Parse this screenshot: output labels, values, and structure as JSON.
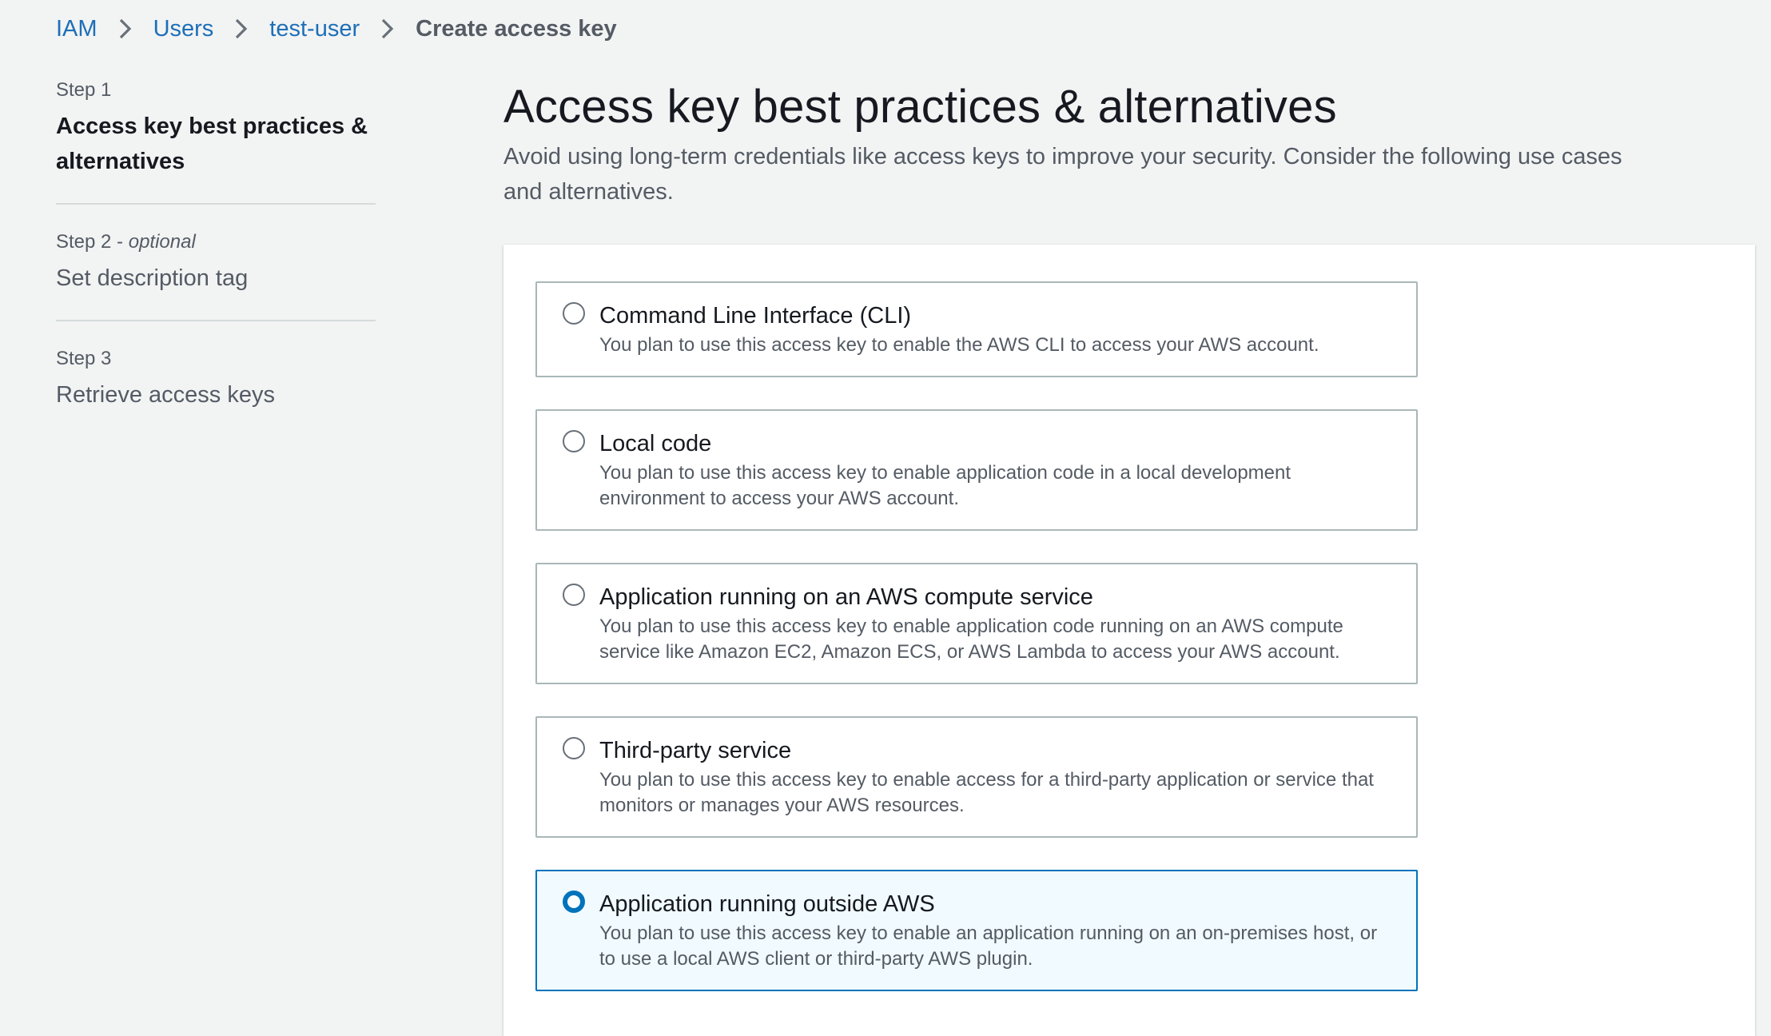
{
  "breadcrumb": {
    "items": [
      {
        "label": "IAM"
      },
      {
        "label": "Users"
      },
      {
        "label": "test-user"
      }
    ],
    "current": "Create access key"
  },
  "steps": [
    {
      "number": "Step 1",
      "optional": "",
      "title": "Access key best practices & alternatives"
    },
    {
      "number": "Step 2",
      "optional": "optional",
      "title": "Set description tag"
    },
    {
      "number": "Step 3",
      "optional": "",
      "title": "Retrieve access keys"
    }
  ],
  "main": {
    "title": "Access key best practices & alternatives",
    "description": "Avoid using long-term credentials like access keys to improve your security. Consider the following use cases and alternatives."
  },
  "options": [
    {
      "title": "Command Line Interface (CLI)",
      "description": "You plan to use this access key to enable the AWS CLI to access your AWS account.",
      "selected": false
    },
    {
      "title": "Local code",
      "description": "You plan to use this access key to enable application code in a local development environment to access your AWS account.",
      "selected": false
    },
    {
      "title": "Application running on an AWS compute service",
      "description": "You plan to use this access key to enable application code running on an AWS compute service like Amazon EC2, Amazon ECS, or AWS Lambda to access your AWS account.",
      "selected": false
    },
    {
      "title": "Third-party service",
      "description": "You plan to use this access key to enable access for a third-party application or service that monitors or manages your AWS resources.",
      "selected": false
    },
    {
      "title": "Application running outside AWS",
      "description": "You plan to use this access key to enable an application running on an on-premises host, or to use a local AWS client or third-party AWS plugin.",
      "selected": true
    }
  ],
  "colors": {
    "link": "#1d6fb8",
    "selected_border": "#0073bb",
    "selected_bg": "#f1faff",
    "background": "#f2f3f3"
  },
  "icons": {
    "breadcrumb_separator": "chevron-right-icon"
  }
}
